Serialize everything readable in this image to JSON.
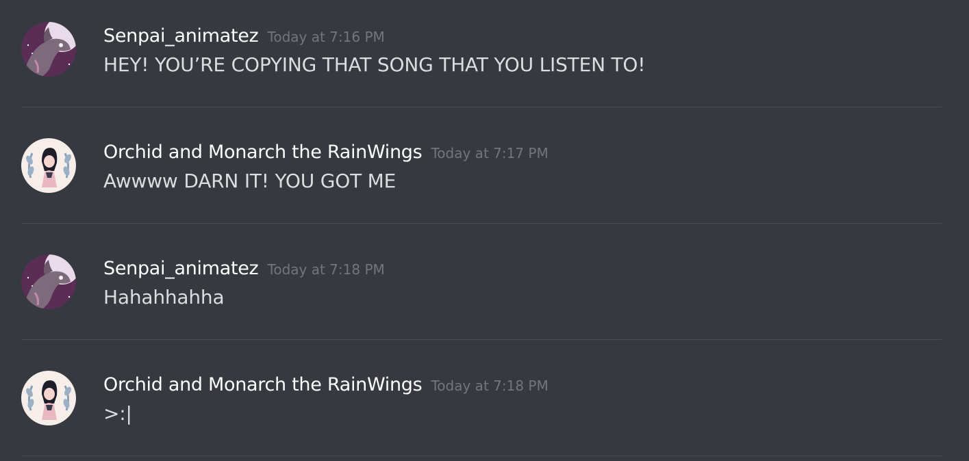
{
  "messages": [
    {
      "author": "Senpai_animatez",
      "timestamp": "Today at 7:16 PM",
      "text": "HEY! YOU’RE COPYING THAT SONG THAT YOU LISTEN TO!",
      "avatar": "dragon-avatar"
    },
    {
      "author": "Orchid and Monarch the RainWings",
      "timestamp": "Today at 7:17 PM",
      "text": "Awwww DARN IT! YOU GOT ME",
      "avatar": "girl-wreath-avatar"
    },
    {
      "author": "Senpai_animatez",
      "timestamp": "Today at 7:18 PM",
      "text": "Hahahhahha",
      "avatar": "dragon-avatar"
    },
    {
      "author": "Orchid and Monarch the RainWings",
      "timestamp": "Today at 7:18 PM",
      "text": ">:|",
      "avatar": "girl-wreath-avatar"
    }
  ],
  "colors": {
    "background": "#36393f",
    "username": "#ffffff",
    "timestamp": "#72767d",
    "message_text": "#dcddde",
    "divider": "#4a4d53"
  }
}
